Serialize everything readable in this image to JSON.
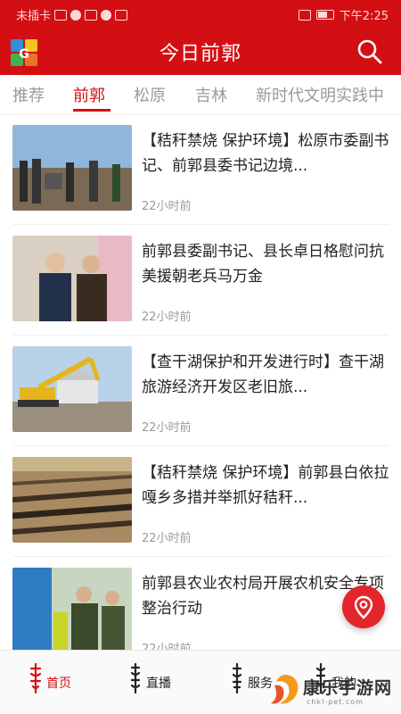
{
  "status_bar": {
    "carrier": "未插卡",
    "time": "下午2:25"
  },
  "header": {
    "title": "今日前郭"
  },
  "tabs": [
    {
      "label": "推荐"
    },
    {
      "label": "前郭"
    },
    {
      "label": "松原"
    },
    {
      "label": "吉林"
    },
    {
      "label": "新时代文明实践中"
    }
  ],
  "news": [
    {
      "title": "【秸秆禁烧 保护环境】松原市委副书记、前郭县委书记边境...",
      "time": "22小时前"
    },
    {
      "title": "前郭县委副书记、县长卓日格慰问抗美援朝老兵马万金",
      "time": "22小时前"
    },
    {
      "title": "【查干湖保护和开发进行时】查干湖旅游经济开发区老旧旅...",
      "time": "22小时前"
    },
    {
      "title": "【秸秆禁烧 保护环境】前郭县白依拉嘎乡多措并举抓好秸秆...",
      "time": "22小时前"
    },
    {
      "title": "前郭县农业农村局开展农机安全专项整治行动",
      "time": "22小时前"
    }
  ],
  "bottom_nav": [
    {
      "label": "首页"
    },
    {
      "label": "直播"
    },
    {
      "label": "服务"
    },
    {
      "label": "我的"
    }
  ],
  "watermark": {
    "text": "康乐手游网",
    "sub": "chkl-pet.com"
  },
  "colors": {
    "brand_red": "#d40f14"
  }
}
